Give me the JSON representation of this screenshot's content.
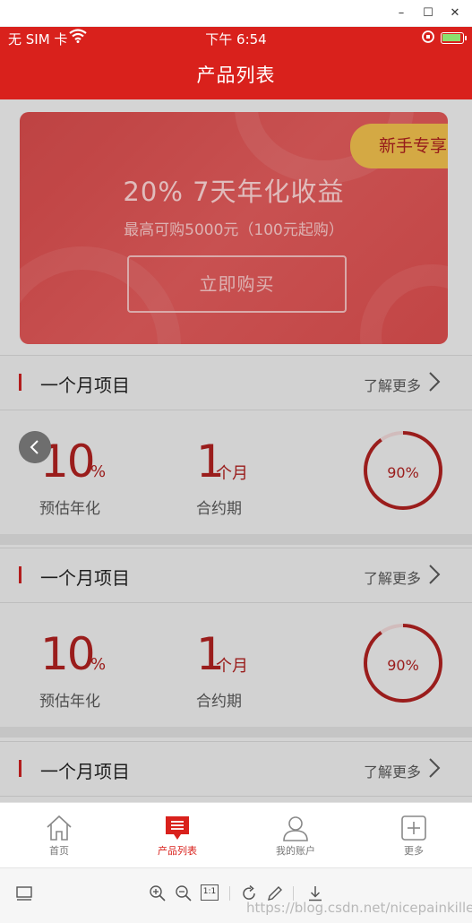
{
  "window": {
    "minimize_label": "–",
    "maximize_label": "☐",
    "close_label": "✕"
  },
  "status_bar": {
    "carrier": "无 SIM 卡",
    "time": "下午 6:54"
  },
  "nav": {
    "title": "产品列表"
  },
  "banner": {
    "badge": "新手专享",
    "headline": "20% 7天年化收益",
    "subline": "最高可购5000元（100元起购）",
    "button": "立即购买"
  },
  "sections": [
    {
      "title": "一个月项目",
      "more": "了解更多",
      "rate": "10",
      "rate_unit": "%",
      "rate_label": "预估年化",
      "term": "1",
      "term_unit": "个月",
      "term_label": "合约期",
      "progress_text": "90%",
      "progress": 0.9
    },
    {
      "title": "一个月项目",
      "more": "了解更多",
      "rate": "10",
      "rate_unit": "%",
      "rate_label": "预估年化",
      "term": "1",
      "term_unit": "个月",
      "term_label": "合约期",
      "progress_text": "90%",
      "progress": 0.9
    },
    {
      "title": "一个月项目",
      "more": "了解更多"
    }
  ],
  "tabbar": {
    "items": [
      {
        "label": "首页",
        "icon": "home-icon",
        "active": false
      },
      {
        "label": "产品列表",
        "icon": "list-icon",
        "active": true
      },
      {
        "label": "我的账户",
        "icon": "user-icon",
        "active": false
      },
      {
        "label": "更多",
        "icon": "plus-square-icon",
        "active": false
      }
    ]
  },
  "toolbar": {
    "actual_size_label": "1:1",
    "watermark": "https://blog.csdn.net/nicepainkiller"
  },
  "colors": {
    "brand_red": "#d9211c",
    "accent_gold": "#e6b84a",
    "value_red": "#a8201f"
  }
}
